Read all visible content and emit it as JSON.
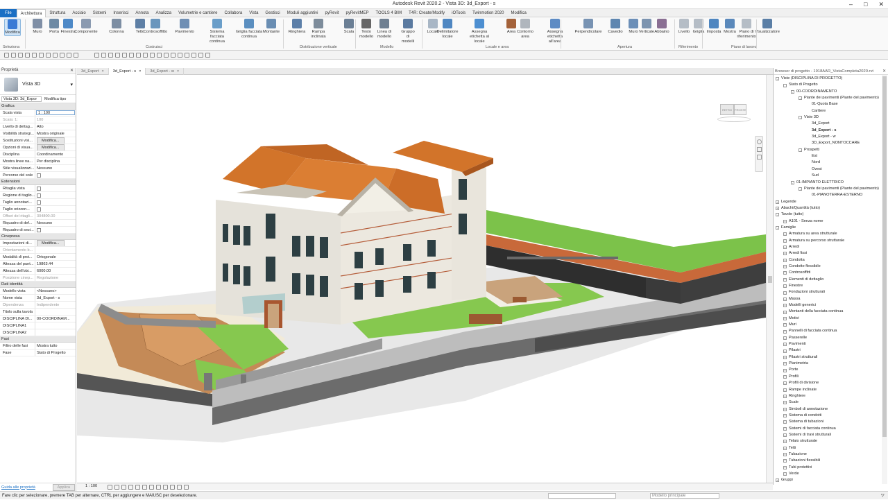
{
  "titlebar": {
    "title": "Autodesk Revit 2020.2 - Vista 3D: 3d_Export - s"
  },
  "tabs": [
    "File",
    "Architettura",
    "Struttura",
    "Acciaio",
    "Sistemi",
    "Inserisci",
    "Annota",
    "Analizza",
    "Volumetrie e cantiere",
    "Collabora",
    "Vista",
    "Gestisci",
    "Moduli aggiuntivi",
    "pyRevit",
    "pyRevitMEP",
    "TOOLS 4 BIM",
    "T4R: Create/Modify",
    "iOTools",
    "Twinmotion 2020",
    "Modifica"
  ],
  "ribbon": {
    "buttons": [
      "Modifica",
      "Muro",
      "Porta",
      "Finestra",
      "Componente",
      "Colonna",
      "Tetto",
      "Controsoffitto",
      "Pavimento",
      "Sistema facciata continua",
      "Griglia facciata continua",
      "Montante",
      "Ringhiera",
      "Rampa inclinata",
      "Scala",
      "Testo modello",
      "Linea di modello",
      "Gruppo di modelli",
      "Locale",
      "Delimitatore locale",
      "Assegna etichetta al locale",
      "Area",
      "Contorno area",
      "Assegna etichetta all'area",
      "Perpendicolare",
      "Cavedio",
      "Muro",
      "Verticale",
      "Abbaino",
      "Livello",
      "Griglia",
      "Imposta",
      "Mostra",
      "Piano di riferimento",
      "Visualizzatore"
    ],
    "groups": [
      "Seleziona",
      "Costruisci",
      "Distribuzione verticale",
      "Modello",
      "Locale e area",
      "Apertura",
      "Riferimento",
      "Piano di lavoro"
    ]
  },
  "properties": {
    "panel_title": "Proprietà",
    "type_name": "Vista 3D",
    "view_selector": "Vista 3D: 3d_Expor",
    "edit_type": "Modifica tipo",
    "sections": {
      "grafica": "Grafica",
      "estensioni": "Estensioni",
      "cinepresa": "Cinepresa",
      "dati": "Dati identità",
      "fasi": "Fasi"
    },
    "grafica": [
      [
        "Scala vista",
        "1 : 100"
      ],
      [
        "Scala: 1:",
        "100"
      ],
      [
        "Livello di dettag...",
        "Alto"
      ],
      [
        "Visibilità strategi...",
        "Mostra originale"
      ],
      [
        "Sostituzioni visi...",
        "Modifica..."
      ],
      [
        "Opzioni di visua...",
        "Modifica..."
      ],
      [
        "Disciplina",
        "Coordinamento"
      ],
      [
        "Mostra linee na...",
        "Per disciplina"
      ],
      [
        "Stile visualizzazi...",
        "Nessuno"
      ],
      [
        "Percorso del sole",
        ""
      ]
    ],
    "estensioni": [
      [
        "Ritaglia vista",
        ""
      ],
      [
        "Regione di taglio...",
        ""
      ],
      [
        "Taglio annotazi...",
        ""
      ],
      [
        "Taglio orizzon...",
        ""
      ],
      [
        "Offset del ritagli...",
        "304800.00"
      ],
      [
        "Riquadro di def...",
        "Nessuno"
      ],
      [
        "Riquadro di sezi...",
        ""
      ]
    ],
    "cinepresa": [
      [
        "Impostazioni di...",
        "Modifica..."
      ],
      [
        "Orientamento b...",
        ""
      ],
      [
        "Modalità di proi...",
        "Ortogonale"
      ],
      [
        "Altezza del punt...",
        "19863.44"
      ],
      [
        "Altezza dell'obi...",
        "6000.00"
      ],
      [
        "Posizione cinep...",
        "Regolazione"
      ]
    ],
    "dati": [
      [
        "Modello vista",
        "<Nessuno>"
      ],
      [
        "Nome vista",
        "3d_Export - s"
      ],
      [
        "Dipendenza",
        "Indipendente"
      ],
      [
        "Titolo sulla tavola",
        ""
      ],
      [
        "DISCIPLINA DI...",
        "00-COORDINAM..."
      ],
      [
        "DISCIPLINA1",
        ""
      ],
      [
        "DISCIPLINA2",
        ""
      ]
    ],
    "fasi": [
      [
        "Filtro delle fasi",
        "Mostra tutto"
      ],
      [
        "Fase",
        "Stato di Progetto"
      ]
    ],
    "help_link": "Guida alle proprietà",
    "apply": "Applica"
  },
  "view_tabs": [
    "3d_Export",
    "3d_Export - s",
    "3d_Export - w"
  ],
  "view_bar": {
    "scale": "1 : 100"
  },
  "browser": {
    "title": "Browser di progetto - 1918AAR_VistaCompleta2020.rvt",
    "items": [
      {
        "t": "Viste (DISCIPLINA DI PROGETTO)",
        "l": 0,
        "e": "-"
      },
      {
        "t": "Stato di Progetto",
        "l": 1,
        "e": "-"
      },
      {
        "t": "00-COORDINAMENTO",
        "l": 2,
        "e": "-"
      },
      {
        "t": "Piante dei pavimenti (Piante del pavimento)",
        "l": 3,
        "e": "-"
      },
      {
        "t": "01-Quota Base",
        "l": 4
      },
      {
        "t": "Carttere",
        "l": 4
      },
      {
        "t": "Viste 3D",
        "l": 3,
        "e": "-"
      },
      {
        "t": "3d_Export",
        "l": 4
      },
      {
        "t": "3d_Export - s",
        "l": 4,
        "b": true
      },
      {
        "t": "3d_Export - w",
        "l": 4
      },
      {
        "t": "3D_Export_NONTOCCARE",
        "l": 4
      },
      {
        "t": "Prospetti",
        "l": 3,
        "e": "-"
      },
      {
        "t": "Est",
        "l": 4
      },
      {
        "t": "Nord",
        "l": 4
      },
      {
        "t": "Ovest",
        "l": 4
      },
      {
        "t": "Sud",
        "l": 4
      },
      {
        "t": "01-IMPIANTO ELETTRICO",
        "l": 2,
        "e": "-"
      },
      {
        "t": "Piante dei pavimenti (Piante del pavimento)",
        "l": 3,
        "e": "-"
      },
      {
        "t": "01-PIANOTERRA-ESTERNO",
        "l": 4
      },
      {
        "t": "Legende",
        "l": 0,
        "e": "+"
      },
      {
        "t": "Abachi/Quantità (tutto)",
        "l": 0,
        "e": "+"
      },
      {
        "t": "Tavole (tutto)",
        "l": 0,
        "e": "-"
      },
      {
        "t": "A101 - Senza nome",
        "l": 1,
        "e": "+"
      },
      {
        "t": "Famiglie",
        "l": 0,
        "e": "-"
      },
      {
        "t": "Armatura su area strutturale",
        "l": 1,
        "e": "+"
      },
      {
        "t": "Armatura su percorso strutturale",
        "l": 1,
        "e": "+"
      },
      {
        "t": "Arredi",
        "l": 1,
        "e": "+"
      },
      {
        "t": "Arredi fissi",
        "l": 1,
        "e": "+"
      },
      {
        "t": "Condotta",
        "l": 1,
        "e": "+"
      },
      {
        "t": "Condotte flessibile",
        "l": 1,
        "e": "+"
      },
      {
        "t": "Controsoffitti",
        "l": 1,
        "e": "+"
      },
      {
        "t": "Elementi di dettaglio",
        "l": 1,
        "e": "+"
      },
      {
        "t": "Finestre",
        "l": 1,
        "e": "+"
      },
      {
        "t": "Fondazioni strutturali",
        "l": 1,
        "e": "+"
      },
      {
        "t": "Massa",
        "l": 1,
        "e": "+"
      },
      {
        "t": "Modelli generici",
        "l": 1,
        "e": "+"
      },
      {
        "t": "Montanti della facciata continua",
        "l": 1,
        "e": "+"
      },
      {
        "t": "Motivi",
        "l": 1,
        "e": "+"
      },
      {
        "t": "Muri",
        "l": 1,
        "e": "+"
      },
      {
        "t": "Pannelli di facciata continua",
        "l": 1,
        "e": "+"
      },
      {
        "t": "Passerelle",
        "l": 1,
        "e": "+"
      },
      {
        "t": "Pavimenti",
        "l": 1,
        "e": "+"
      },
      {
        "t": "Pilastri",
        "l": 1,
        "e": "+"
      },
      {
        "t": "Pilastri strutturali",
        "l": 1,
        "e": "+"
      },
      {
        "t": "Planimetria",
        "l": 1,
        "e": "+"
      },
      {
        "t": "Porte",
        "l": 1,
        "e": "+"
      },
      {
        "t": "Profili",
        "l": 1,
        "e": "+"
      },
      {
        "t": "Profili di divisione",
        "l": 1,
        "e": "+"
      },
      {
        "t": "Rampe inclinate",
        "l": 1,
        "e": "+"
      },
      {
        "t": "Ringhiere",
        "l": 1,
        "e": "+"
      },
      {
        "t": "Scale",
        "l": 1,
        "e": "+"
      },
      {
        "t": "Simboli di annotazione",
        "l": 1,
        "e": "+"
      },
      {
        "t": "Sistema di condotti",
        "l": 1,
        "e": "+"
      },
      {
        "t": "Sistema di tubazioni",
        "l": 1,
        "e": "+"
      },
      {
        "t": "Sistemi di facciata continua",
        "l": 1,
        "e": "+"
      },
      {
        "t": "Sistemi di travi strutturali",
        "l": 1,
        "e": "+"
      },
      {
        "t": "Telaio strutturale",
        "l": 1,
        "e": "+"
      },
      {
        "t": "Tetti",
        "l": 1,
        "e": "+"
      },
      {
        "t": "Tubazione",
        "l": 1,
        "e": "+"
      },
      {
        "t": "Tubazioni flessibili",
        "l": 1,
        "e": "+"
      },
      {
        "t": "Tubi protettivi",
        "l": 1,
        "e": "+"
      },
      {
        "t": "Verde",
        "l": 1,
        "e": "+"
      },
      {
        "t": "Gruppi",
        "l": 0,
        "e": "+"
      }
    ]
  },
  "viewcube": {
    "left": "RETRO",
    "right": "FRONTE"
  },
  "status": {
    "hint": "Fare clic per selezionare, premere TAB per alternare, CTRL per aggiungere e MAIUSC per deselezionare.",
    "model": "Modello principale"
  },
  "colors": {
    "accent": "#1a6fc4",
    "roof": "#d2742a",
    "grass": "#7cc24a",
    "paving": "#d59a63",
    "facade": "#e9e6df"
  }
}
